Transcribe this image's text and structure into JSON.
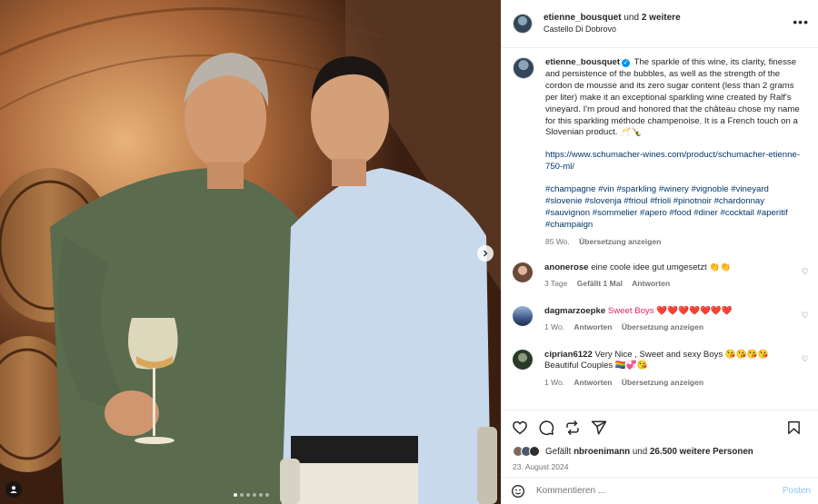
{
  "header": {
    "username": "etienne_bousquet",
    "joiner": "und",
    "others": "2 weitere",
    "location": "Castello Di Dobrovo",
    "more_icon": "more-horizontal-icon"
  },
  "caption": {
    "username": "etienne_bousquet",
    "text": "The sparkle of this wine, its clarity, finesse and persistence of the bubbles, as well as the strength of the cordon de mousse and its zero sugar content (less than 2 grams per liter) make it an exceptional sparkling wine created by Ralf's vineyard. I'm proud and honored that the château chose my name for this sparkling méthode champenoise. It is a French touch on a Slovenian product. 🥂🍾",
    "link": "https://www.schumacher-wines.com/product/schumacher-etienne-750-ml/",
    "hashtags": "#champagne #vin #sparkling #winery #vignoble #vineyard #slovenie #slovenja #frioul #frioli #pinotnoir #chardonnay #sauvignon #sommelier #apero #food #diner #cocktail #aperitif #champaign",
    "age": "85 Wo.",
    "translate": "Übersetzung anzeigen"
  },
  "comments": [
    {
      "username": "anonerose",
      "text": "eine coole idee gut umgesetzt 👏👏",
      "age": "3 Tage",
      "likes": "Gefällt 1 Mal",
      "reply": "Antworten",
      "avatar_color": "#6b4a3a"
    },
    {
      "username": "dagmarzoepke",
      "text": "Sweet Boys ❤️❤️❤️❤️❤️❤️❤️",
      "age": "1 Wo.",
      "reply": "Antworten",
      "translate": "Übersetzung anzeigen",
      "avatar_color": "#3d5a8a"
    },
    {
      "username": "ciprian6122",
      "text": "Very Nice , Sweet and sexy Boys 😘😘😘😘 Beautiful Couples 🏳️‍🌈💞😘",
      "age": "1 Wo.",
      "reply": "Antworten",
      "translate": "Übersetzung anzeigen",
      "avatar_color": "#2a3a2a"
    }
  ],
  "actions": {
    "like_icon": "heart-icon",
    "comment_icon": "comment-icon",
    "repost_icon": "repost-icon",
    "share_icon": "share-icon",
    "save_icon": "bookmark-icon"
  },
  "likes": {
    "prefix": "Gefällt",
    "user": "nbroenimann",
    "joiner": "und",
    "count": "26.500 weitere Personen"
  },
  "date": "23. August 2024",
  "composer": {
    "placeholder": "Kommentieren ...",
    "post_label": "Posten"
  },
  "carousel": {
    "slide_count": 6,
    "active_index": 0
  },
  "colors": {
    "link": "#00376b",
    "verified": "#0095f6",
    "post_button": "#8fc5f7",
    "meta": "#737373"
  }
}
